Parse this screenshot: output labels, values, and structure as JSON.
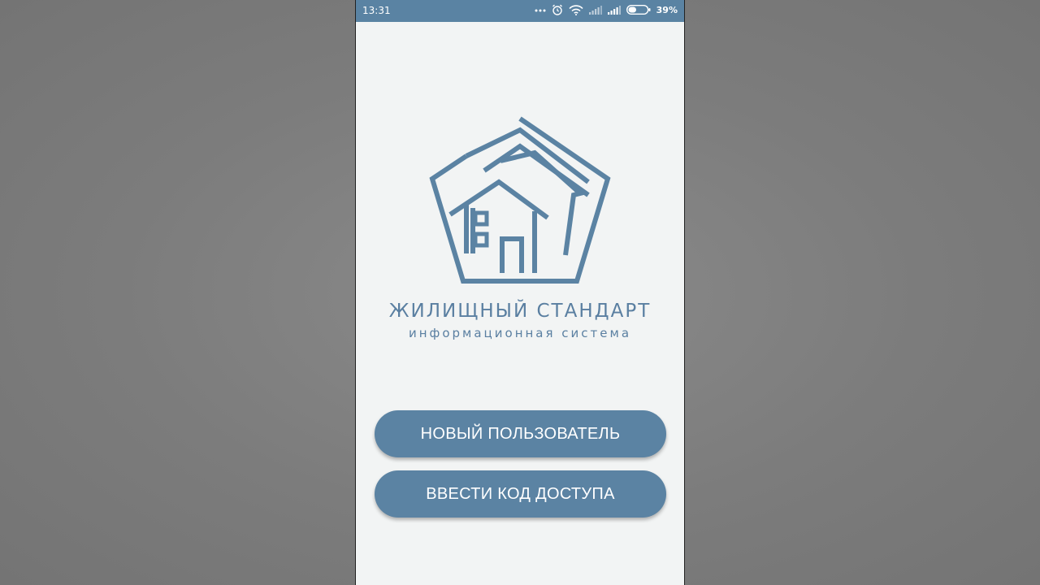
{
  "status_bar": {
    "time": "13:31",
    "battery": "39%",
    "icons": [
      "more-dots-icon",
      "alarm-icon",
      "wifi-icon",
      "signal-icon-1",
      "signal-icon-2",
      "battery-icon"
    ]
  },
  "brand": {
    "title": "ЖИЛИЩНЫЙ СТАНДАРТ",
    "subtitle": "информационная система",
    "logo_icon": "house-pentagon-logo-icon"
  },
  "buttons": {
    "new_user": "НОВЫЙ ПОЛЬЗОВАТЕЛЬ",
    "enter_code": "ВВЕСТИ КОД ДОСТУПА"
  },
  "colors": {
    "accent": "#5b83a3",
    "background": "#f2f4f4",
    "status_bar": "#5a83a3",
    "text_on_accent": "#ffffff"
  }
}
